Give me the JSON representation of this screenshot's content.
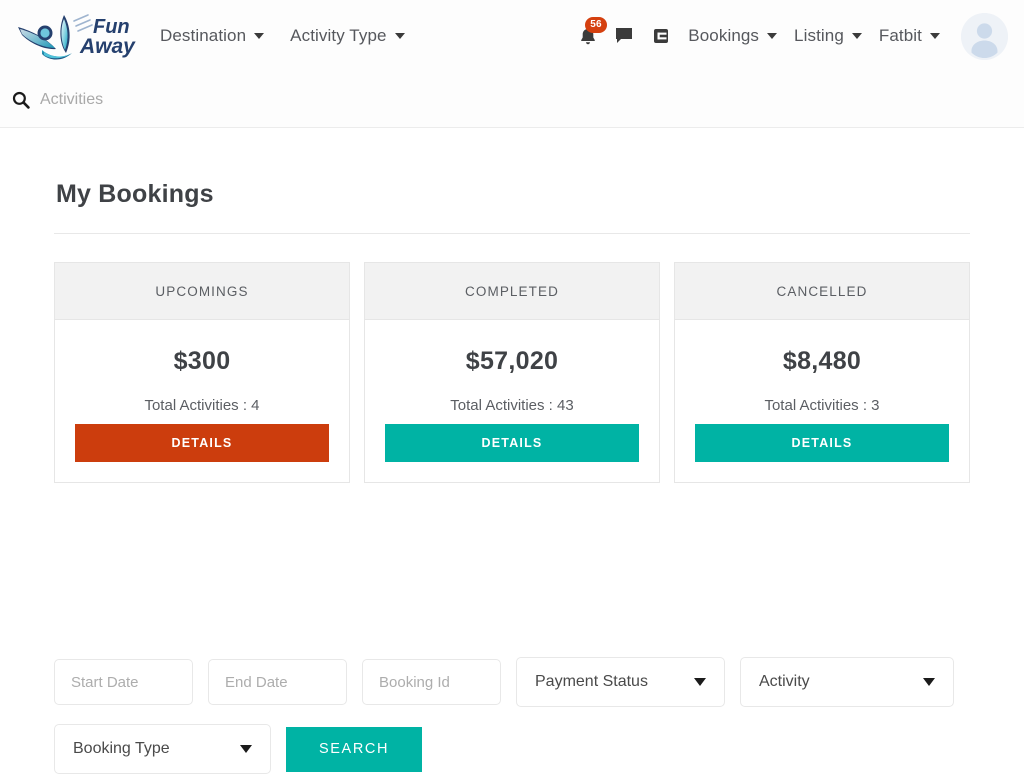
{
  "colors": {
    "teal": "#00b3a4",
    "orange": "#cc3d0d",
    "badge_red": "#d5400f",
    "logo_navy": "#22355f",
    "logo_teal": "#2fb3c8",
    "text_dark": "#3f4246",
    "text_muted": "#5b5e63",
    "placeholder": "#adadad",
    "border": "#e8e8e8",
    "card_head_bg": "#f2f2f2"
  },
  "header": {
    "logo": {
      "icon_name": "funaway-bird-logo",
      "line1": "Fun",
      "line2": "Away"
    },
    "nav": [
      {
        "label": "Destination",
        "icon": "chevron-down-icon"
      },
      {
        "label": "Activity Type",
        "icon": "chevron-down-icon"
      }
    ],
    "notifications": {
      "icon": "bell-icon",
      "count": "56"
    },
    "messages": {
      "icon": "chat-bubble-icon"
    },
    "logout": {
      "icon": "logout-icon"
    },
    "account_nav": [
      {
        "label": "Bookings",
        "icon": "chevron-down-icon"
      },
      {
        "label": "Listing",
        "icon": "chevron-down-icon"
      },
      {
        "label": "Fatbit",
        "icon": "chevron-down-icon"
      }
    ],
    "avatar": {
      "icon": "user-avatar-icon"
    },
    "search": {
      "icon": "search-icon",
      "value": "",
      "placeholder": "Activities"
    }
  },
  "main": {
    "page_title": "My Bookings",
    "cards": [
      {
        "title": "UPCOMINGS",
        "amount": "$300",
        "activities": "Total Activities : 4",
        "button_label": "DETAILS",
        "button_color": "#cc3d0d"
      },
      {
        "title": "COMPLETED",
        "amount": "$57,020",
        "activities": "Total Activities : 43",
        "button_label": "DETAILS",
        "button_color": "#00b3a4"
      },
      {
        "title": "CANCELLED",
        "amount": "$8,480",
        "activities": "Total Activities : 3",
        "button_label": "DETAILS",
        "button_color": "#00b3a4"
      }
    ]
  },
  "filters": {
    "start_date": {
      "value": "",
      "placeholder": "Start Date"
    },
    "end_date": {
      "value": "",
      "placeholder": "End Date"
    },
    "booking_id": {
      "value": "",
      "placeholder": "Booking Id"
    },
    "payment_status": {
      "selected": "Payment Status",
      "icon": "chevron-down-icon"
    },
    "activity": {
      "selected": "Activity",
      "icon": "chevron-down-icon"
    },
    "booking_type": {
      "selected": "Booking Type",
      "icon": "chevron-down-icon"
    },
    "search_button": "SEARCH"
  }
}
